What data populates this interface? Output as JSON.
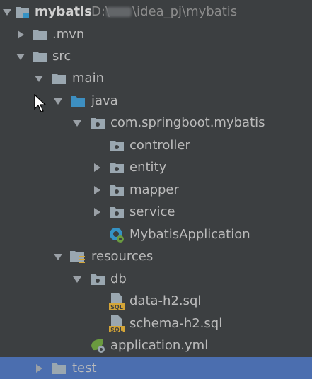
{
  "project": {
    "name": "mybatis",
    "path_drive": "D:\\",
    "path_rest": "\\idea_pj\\mybatis"
  },
  "tree": [
    {
      "label": "mybatis",
      "icon": "module-folder-icon",
      "arrow": "down"
    },
    {
      "label": ".mvn",
      "icon": "folder-icon",
      "arrow": "right"
    },
    {
      "label": "src",
      "icon": "folder-icon",
      "arrow": "down"
    },
    {
      "label": "main",
      "icon": "folder-icon",
      "arrow": "down"
    },
    {
      "label": "java",
      "icon": "source-root-folder-icon",
      "arrow": "down"
    },
    {
      "label": "com.springboot.mybatis",
      "icon": "package-icon",
      "arrow": "down"
    },
    {
      "label": "controller",
      "icon": "package-icon",
      "arrow": "none"
    },
    {
      "label": "entity",
      "icon": "package-icon",
      "arrow": "right"
    },
    {
      "label": "mapper",
      "icon": "package-icon",
      "arrow": "right"
    },
    {
      "label": "service",
      "icon": "package-icon",
      "arrow": "right"
    },
    {
      "label": "MybatisApplication",
      "icon": "spring-boot-class-icon",
      "arrow": "none"
    },
    {
      "label": "resources",
      "icon": "resources-root-folder-icon",
      "arrow": "down"
    },
    {
      "label": "db",
      "icon": "package-icon",
      "arrow": "down"
    },
    {
      "label": "data-h2.sql",
      "icon": "sql-file-icon",
      "arrow": "none"
    },
    {
      "label": "schema-h2.sql",
      "icon": "sql-file-icon",
      "arrow": "none"
    },
    {
      "label": "application.yml",
      "icon": "spring-config-file-icon",
      "arrow": "none"
    },
    {
      "label": "test",
      "icon": "folder-icon",
      "arrow": "right",
      "selected": true
    }
  ],
  "colors": {
    "background": "#3c3f41",
    "selection": "#4b6eaf",
    "text": "#bbbbbb",
    "folder": "#9aa7b0",
    "source_root": "#3d8fc1",
    "sql": "#d4a537",
    "spring": "#6a9b3f"
  }
}
